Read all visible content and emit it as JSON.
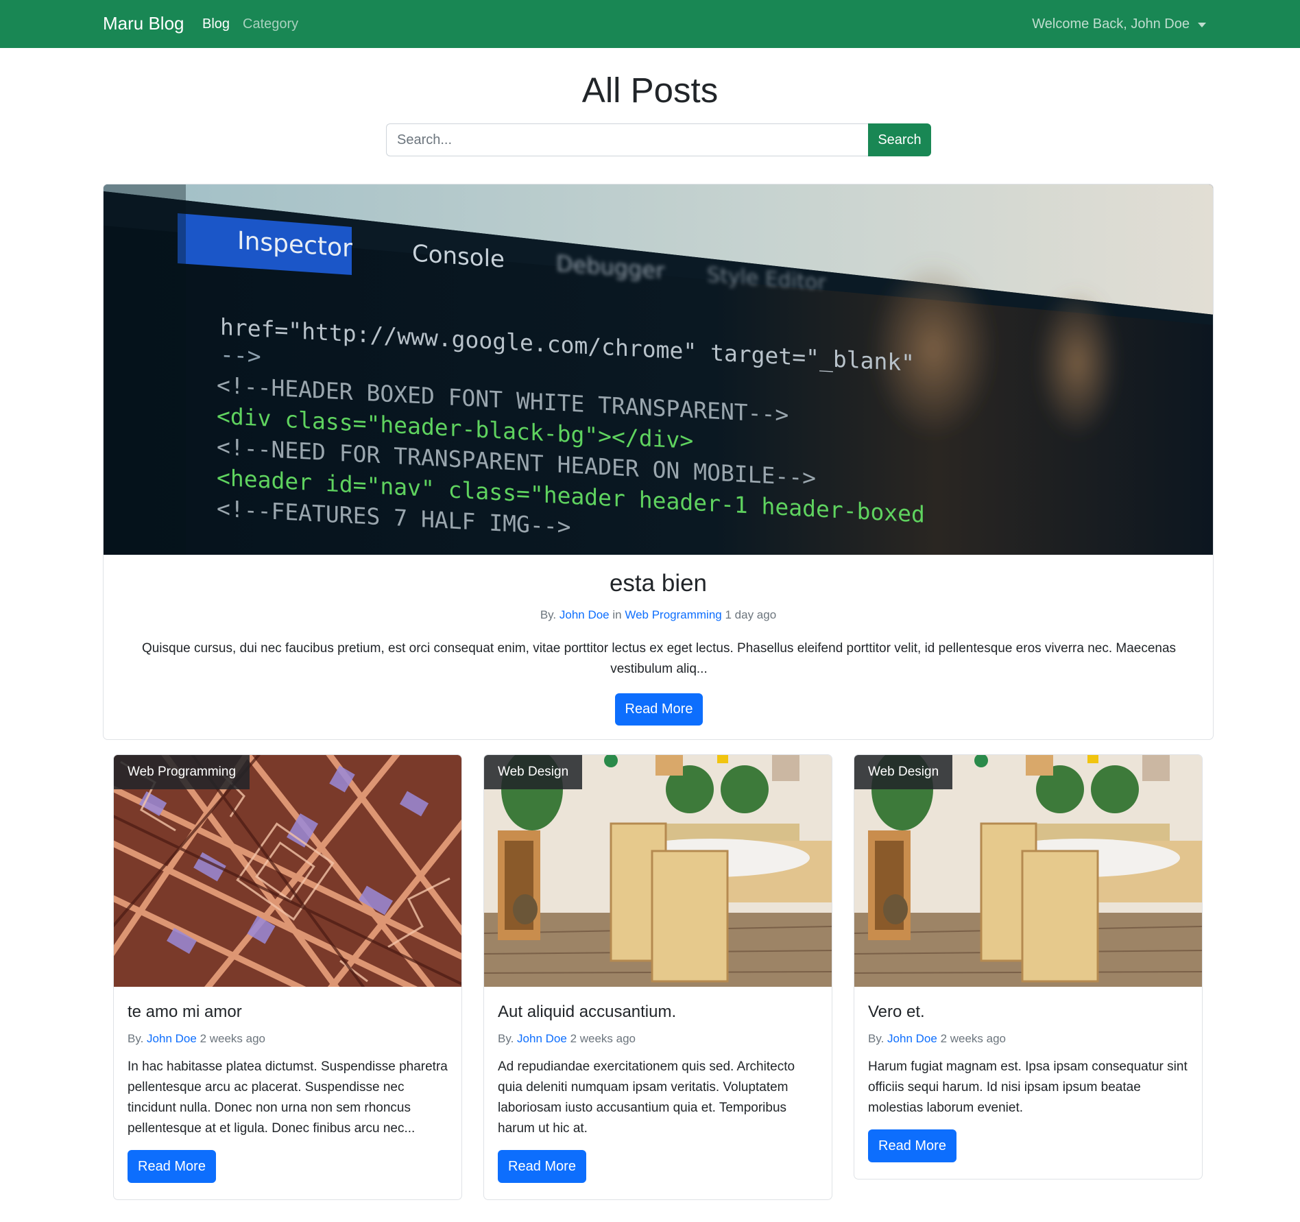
{
  "navbar": {
    "brand": "Maru Blog",
    "links": [
      "Blog",
      "Category"
    ],
    "user_menu": "Welcome Back, John Doe",
    "color": "#198754"
  },
  "header": {
    "title": "All Posts",
    "search_placeholder": "Search...",
    "search_button": "Search"
  },
  "featured": {
    "image_icon": "code-editor-photo",
    "image_text": {
      "tab_inspector": "Inspector",
      "tab_console": "Console",
      "tab_debugger": "Debugger",
      "tab_style_editor": "Style Editor",
      "code_lines": [
        "href=\"http://www.google.com/chrome\" target=\"_blank\"",
        "-->",
        "<!--HEADER BOXED FONT WHITE TRANSPARENT-->",
        "<div class=\"header-black-bg\"></div>",
        "<!--NEED FOR TRANSPARENT HEADER ON MOBILE-->",
        "<header id=\"nav\" class=\"header header-1 header-boxed",
        "<!--FEATURES 7 HALF IMG-->"
      ]
    },
    "title": "esta bien",
    "meta_prefix": "By.",
    "author": "John Doe",
    "meta_in": "in",
    "category": "Web Programming",
    "time": "1 day ago",
    "excerpt": "Quisque cursus, dui nec faucibus pretium, est orci consequat enim, vitae porttitor lectus ex eget lectus. Phasellus eleifend porttitor velit, id pellentesque eros viverra nec. Maecenas vestibulum aliq...",
    "button": "Read More"
  },
  "posts": [
    {
      "category": "Web Programming",
      "image_icon": "abstract-circuit-photo",
      "title": "te amo mi amor",
      "meta_prefix": "By.",
      "author": "John Doe",
      "time": "2 weeks ago",
      "excerpt": "In hac habitasse platea dictumst. Suspendisse pharetra pellentesque arcu ac placerat. Suspendisse nec tincidunt nulla. Donec non urna non sem rhoncus pellentesque at et ligula. Donec finibus arcu nec...",
      "button": "Read More"
    },
    {
      "category": "Web Design",
      "image_icon": "dining-room-photo",
      "title": "Aut aliquid accusantium.",
      "meta_prefix": "By.",
      "author": "John Doe",
      "time": "2 weeks ago",
      "excerpt": "Ad repudiandae exercitationem quis sed. Architecto quia deleniti numquam ipsam veritatis. Voluptatem laboriosam iusto accusantium quia et. Temporibus harum ut hic at.",
      "button": "Read More"
    },
    {
      "category": "Web Design",
      "image_icon": "dining-room-photo",
      "title": "Vero et.",
      "meta_prefix": "By.",
      "author": "John Doe",
      "time": "2 weeks ago",
      "excerpt": "Harum fugiat magnam est. Ipsa ipsam consequatur sint officiis sequi harum. Id nisi ipsam ipsum beatae molestias laborum eveniet.",
      "button": "Read More"
    }
  ],
  "colors": {
    "primary": "#0d6efd",
    "success": "#198754",
    "muted": "#6c757d"
  }
}
